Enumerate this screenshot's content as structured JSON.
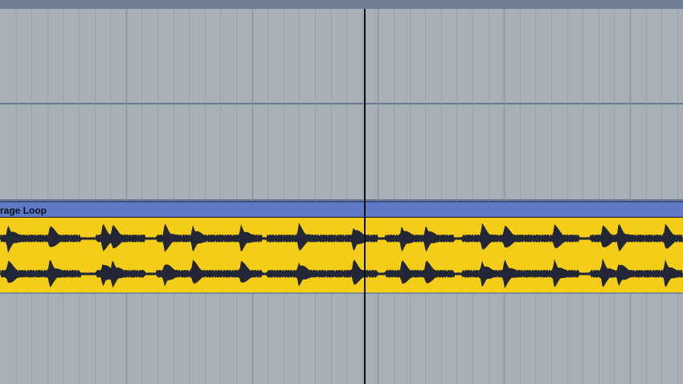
{
  "arrangement": {
    "clip": {
      "name": "rage Loop",
      "header_color": "#5f79c4",
      "body_color": "#f3cd17",
      "waveform_color": "#232636",
      "channels": 2
    },
    "colors": {
      "lane_background": "#a7afb7",
      "grid_line": "#8f98a2",
      "track_separator": "#6b7a8f",
      "playhead": "#111111"
    }
  }
}
